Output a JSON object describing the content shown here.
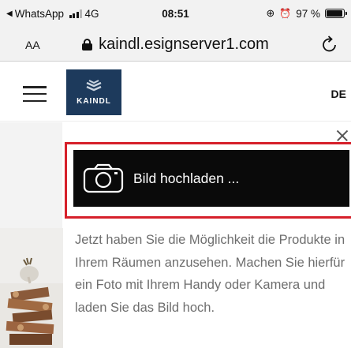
{
  "status_bar": {
    "back_app": "WhatsApp",
    "network": "4G",
    "time": "08:51",
    "battery_percent": "97 %",
    "battery_level": 0.97,
    "icons": [
      "back-arrow-icon",
      "signal-icon",
      "rotation-lock-icon",
      "alarm-icon",
      "battery-icon"
    ]
  },
  "browser": {
    "text_size_label": "AA",
    "url": "kaindl.esignserver1.com",
    "icons": [
      "lock-icon",
      "reload-icon"
    ]
  },
  "header": {
    "logo_text": "KAINDL",
    "language": "DE",
    "brand_color": "#1d3a5c",
    "icons": [
      "menu-icon",
      "logo-mark-icon"
    ]
  },
  "upload": {
    "label": "Bild hochladen ...",
    "button_color": "#0a0a0a",
    "highlight_color": "#d6202a",
    "icons": [
      "camera-icon",
      "close-icon"
    ]
  },
  "description": {
    "text": "Jetzt haben Sie die Möglichkeit die Produkte in Ihrem Räumen anzusehen. Machen Sie hierfür ein Foto mit Ihrem Handy oder Kamera und laden Sie das Bild hoch."
  }
}
